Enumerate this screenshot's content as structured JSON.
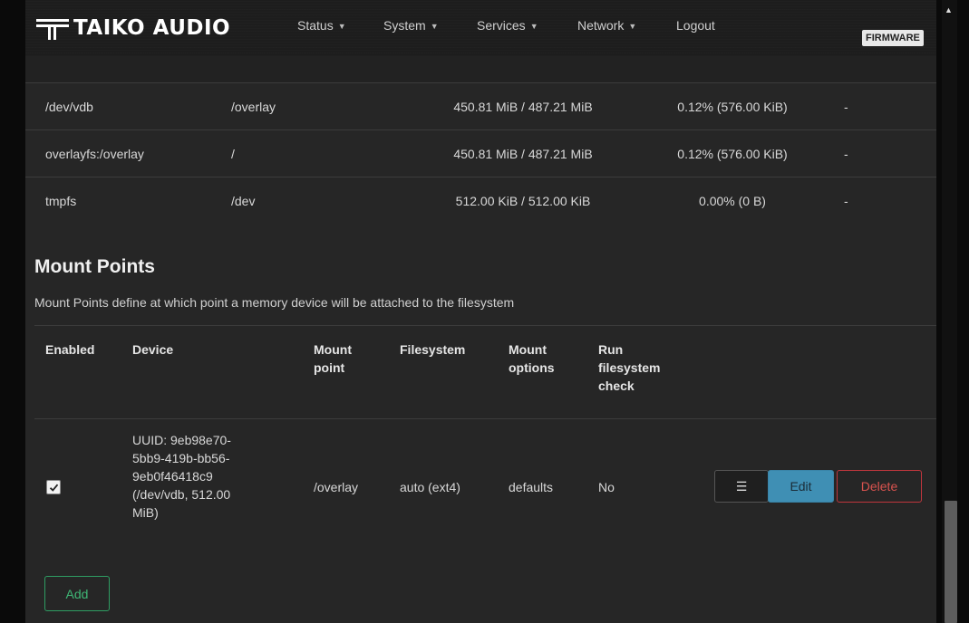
{
  "navbar": {
    "brand": "TAIKO AUDIO",
    "items": [
      {
        "label": "Status",
        "has_dropdown": true
      },
      {
        "label": "System",
        "has_dropdown": true
      },
      {
        "label": "Services",
        "has_dropdown": true
      },
      {
        "label": "Network",
        "has_dropdown": true
      },
      {
        "label": "Logout",
        "has_dropdown": false
      }
    ],
    "badge": "FIRMWARE"
  },
  "storage_rows": [
    {
      "device": "/dev/vdb",
      "mount": "/overlay",
      "usage": "450.81 MiB / 487.21 MiB",
      "reserved": "0.12% (576.00 KiB)",
      "extra": "-"
    },
    {
      "device": "overlayfs:/overlay",
      "mount": "/",
      "usage": "450.81 MiB / 487.21 MiB",
      "reserved": "0.12% (576.00 KiB)",
      "extra": "-"
    },
    {
      "device": "tmpfs",
      "mount": "/dev",
      "usage": "512.00 KiB / 512.00 KiB",
      "reserved": "0.00% (0 B)",
      "extra": "-"
    }
  ],
  "mount_points": {
    "title": "Mount Points",
    "description": "Mount Points define at which point a memory device will be attached to the filesystem",
    "headers": {
      "enabled": "Enabled",
      "device": "Device",
      "mount_point": [
        "Mount",
        "point"
      ],
      "filesystem": "Filesystem",
      "mount_options": [
        "Mount",
        "options"
      ],
      "fsck": [
        "Run",
        "filesystem",
        "check"
      ]
    },
    "rows": [
      {
        "enabled": true,
        "device_lines": [
          "UUID: 9eb98e70-",
          "5bb9-419b-bb56-",
          "9eb0f46418c9",
          "(/dev/vdb, 512.00",
          "MiB)"
        ],
        "mount_point": "/overlay",
        "filesystem": "auto (ext4)",
        "options": "defaults",
        "fsck": "No"
      }
    ],
    "buttons": {
      "menu": "☰",
      "edit": "Edit",
      "delete": "Delete",
      "add": "Add"
    }
  },
  "colors": {
    "edit_button": "#3f8fb4",
    "delete_border": "#c0363d",
    "add_border": "#2e9d62"
  }
}
